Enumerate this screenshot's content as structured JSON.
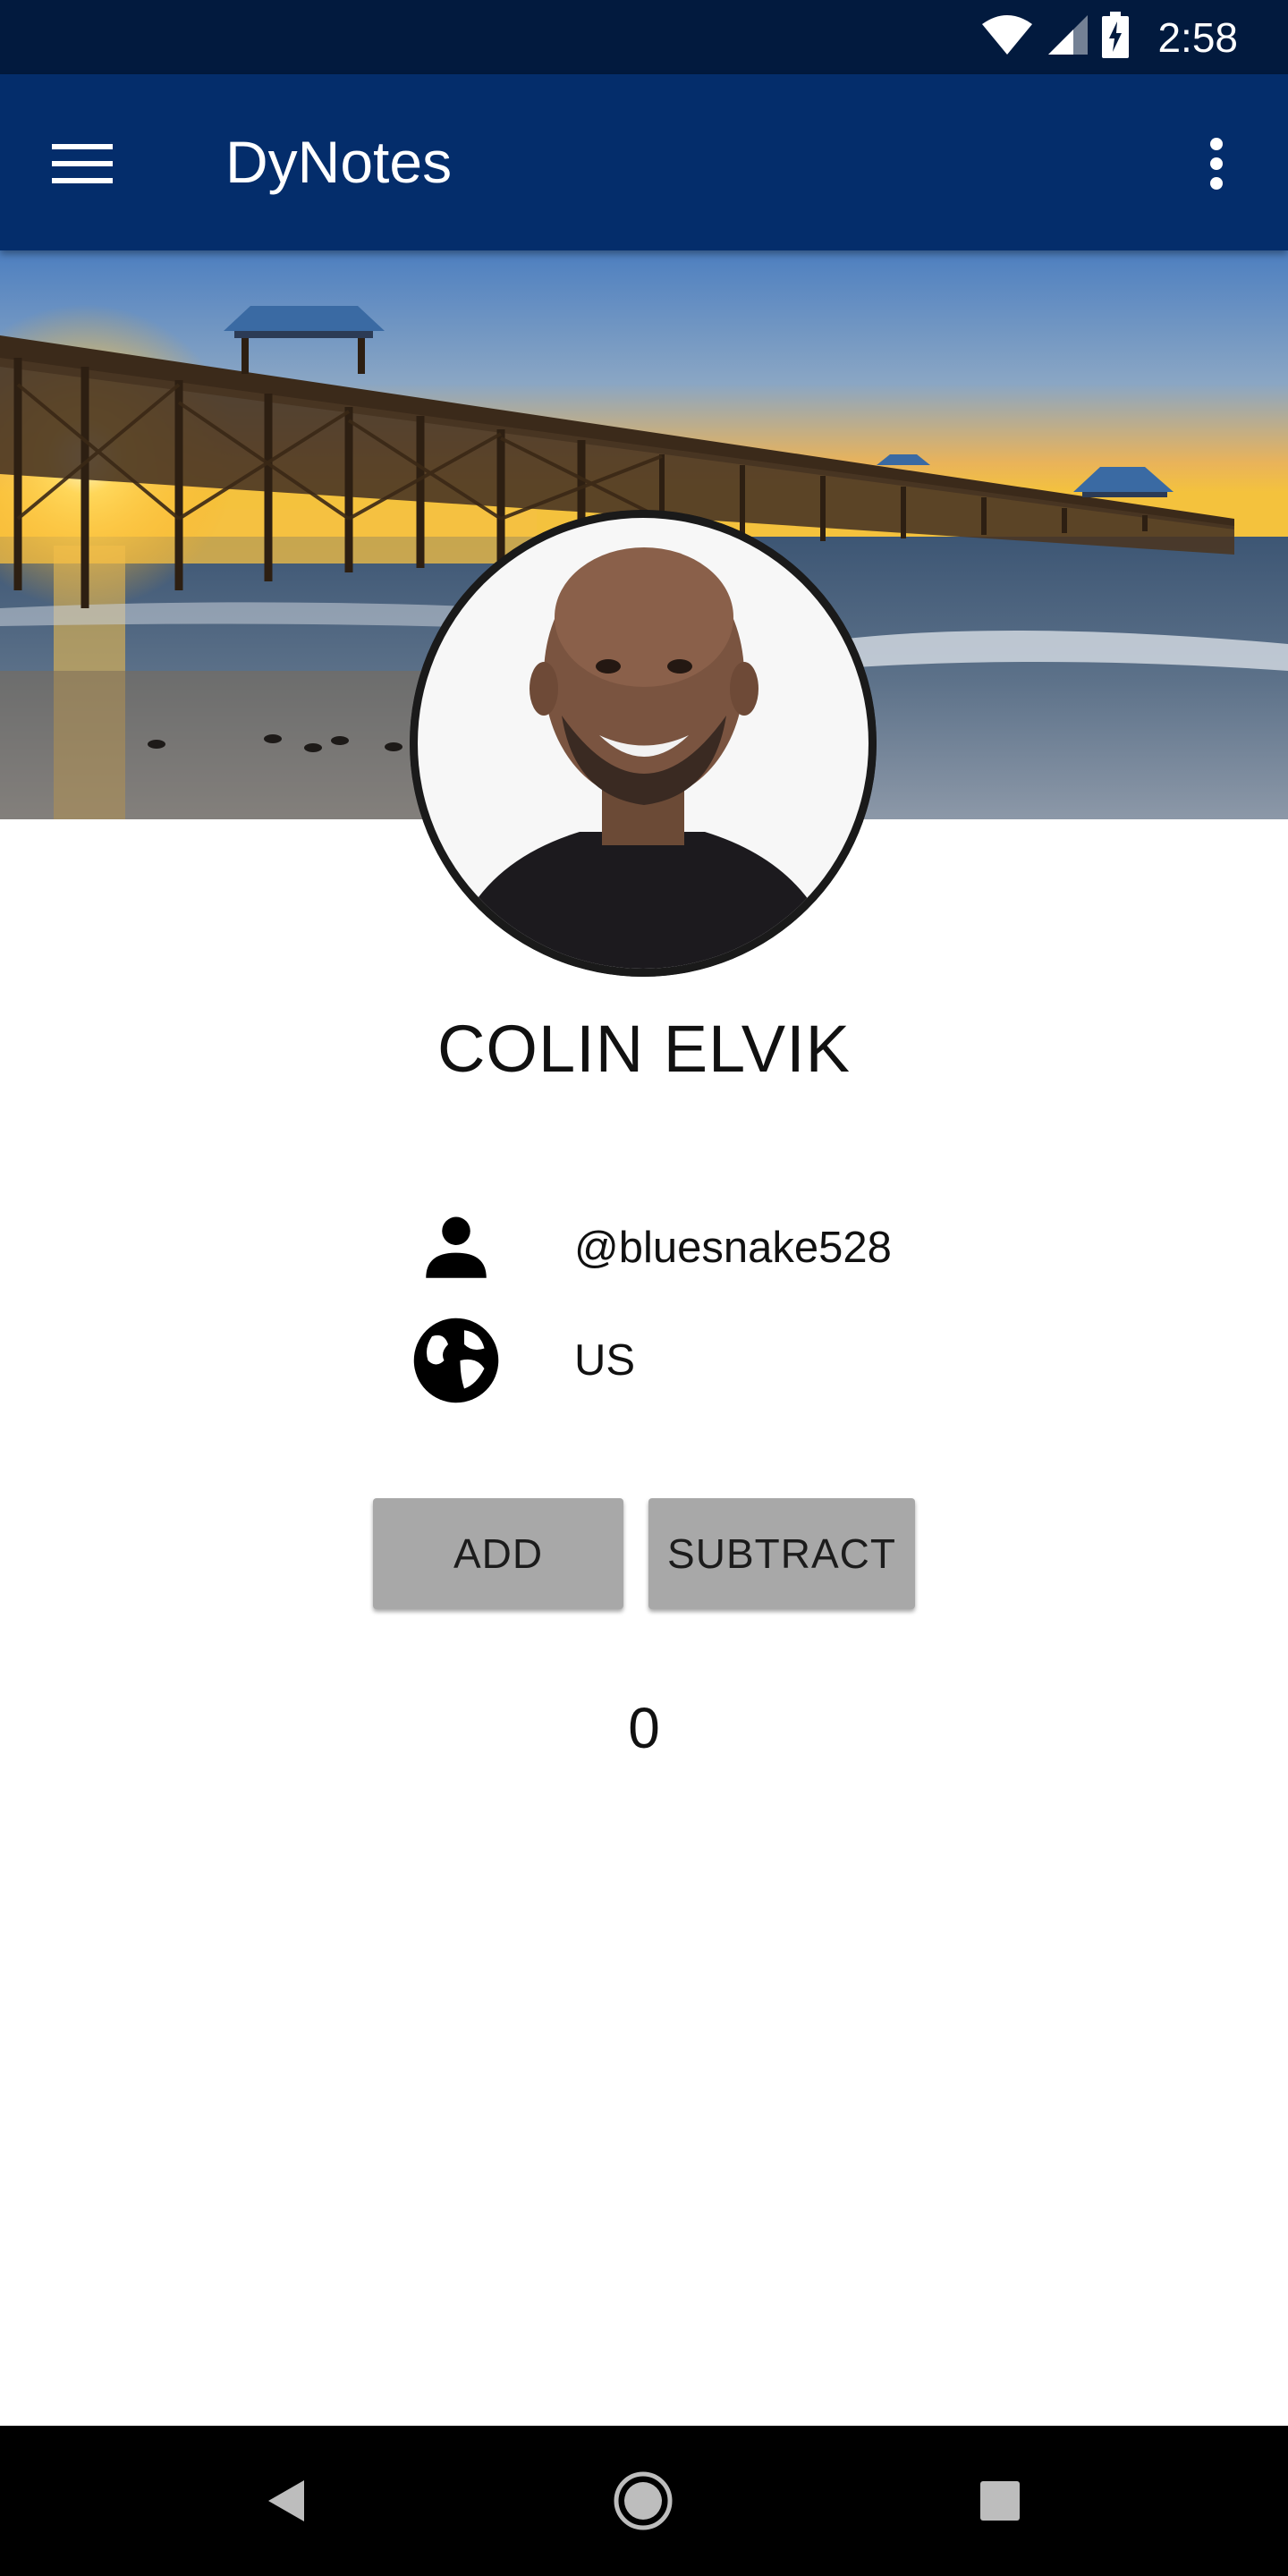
{
  "status_bar": {
    "time": "2:58",
    "icons": [
      "wifi-icon",
      "cell-signal-icon",
      "battery-charging-icon"
    ]
  },
  "app_bar": {
    "title": "DyNotes",
    "menu_icon": "hamburger-menu-icon",
    "overflow_icon": "more-vert-icon"
  },
  "profile": {
    "cover": "pier-sunset-photo",
    "avatar": "profile-photo",
    "name": "COLIN ELVIK",
    "username": "@bluesnake528",
    "username_icon": "person-icon",
    "country": "US",
    "country_icon": "globe-icon"
  },
  "actions": {
    "add_label": "ADD",
    "subtract_label": "SUBTRACT"
  },
  "counter": {
    "value": "0"
  },
  "nav_bar": {
    "icons": [
      "back-icon",
      "home-icon",
      "recents-icon"
    ]
  },
  "colors": {
    "status_bar": "#021a3e",
    "app_bar": "#042d6b",
    "button_bg": "#a8a8a8",
    "text": "#111111"
  }
}
